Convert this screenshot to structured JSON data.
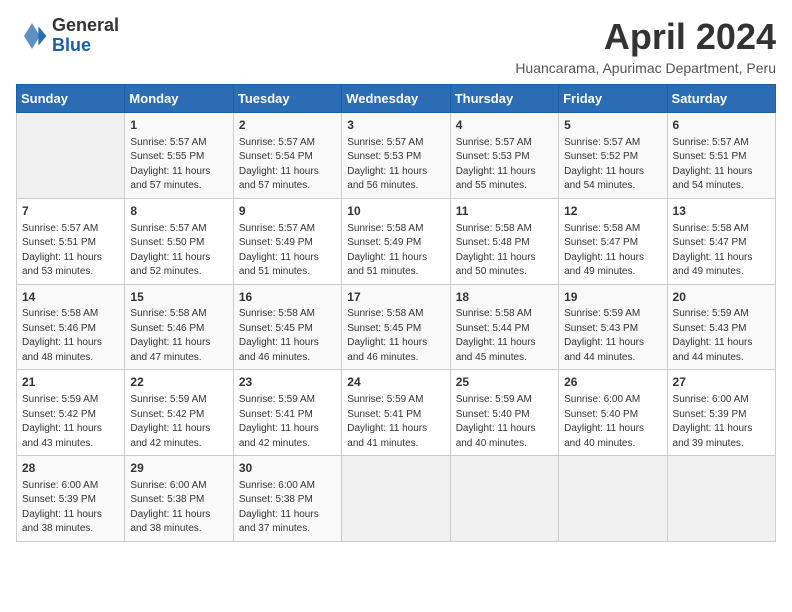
{
  "header": {
    "logo_general": "General",
    "logo_blue": "Blue",
    "month_title": "April 2024",
    "location": "Huancarama, Apurimac Department, Peru"
  },
  "days_of_week": [
    "Sunday",
    "Monday",
    "Tuesday",
    "Wednesday",
    "Thursday",
    "Friday",
    "Saturday"
  ],
  "weeks": [
    [
      {
        "day": "",
        "sunrise": "",
        "sunset": "",
        "daylight": ""
      },
      {
        "day": "1",
        "sunrise": "Sunrise: 5:57 AM",
        "sunset": "Sunset: 5:55 PM",
        "daylight": "Daylight: 11 hours and 57 minutes."
      },
      {
        "day": "2",
        "sunrise": "Sunrise: 5:57 AM",
        "sunset": "Sunset: 5:54 PM",
        "daylight": "Daylight: 11 hours and 57 minutes."
      },
      {
        "day": "3",
        "sunrise": "Sunrise: 5:57 AM",
        "sunset": "Sunset: 5:53 PM",
        "daylight": "Daylight: 11 hours and 56 minutes."
      },
      {
        "day": "4",
        "sunrise": "Sunrise: 5:57 AM",
        "sunset": "Sunset: 5:53 PM",
        "daylight": "Daylight: 11 hours and 55 minutes."
      },
      {
        "day": "5",
        "sunrise": "Sunrise: 5:57 AM",
        "sunset": "Sunset: 5:52 PM",
        "daylight": "Daylight: 11 hours and 54 minutes."
      },
      {
        "day": "6",
        "sunrise": "Sunrise: 5:57 AM",
        "sunset": "Sunset: 5:51 PM",
        "daylight": "Daylight: 11 hours and 54 minutes."
      }
    ],
    [
      {
        "day": "7",
        "sunrise": "Sunrise: 5:57 AM",
        "sunset": "Sunset: 5:51 PM",
        "daylight": "Daylight: 11 hours and 53 minutes."
      },
      {
        "day": "8",
        "sunrise": "Sunrise: 5:57 AM",
        "sunset": "Sunset: 5:50 PM",
        "daylight": "Daylight: 11 hours and 52 minutes."
      },
      {
        "day": "9",
        "sunrise": "Sunrise: 5:57 AM",
        "sunset": "Sunset: 5:49 PM",
        "daylight": "Daylight: 11 hours and 51 minutes."
      },
      {
        "day": "10",
        "sunrise": "Sunrise: 5:58 AM",
        "sunset": "Sunset: 5:49 PM",
        "daylight": "Daylight: 11 hours and 51 minutes."
      },
      {
        "day": "11",
        "sunrise": "Sunrise: 5:58 AM",
        "sunset": "Sunset: 5:48 PM",
        "daylight": "Daylight: 11 hours and 50 minutes."
      },
      {
        "day": "12",
        "sunrise": "Sunrise: 5:58 AM",
        "sunset": "Sunset: 5:47 PM",
        "daylight": "Daylight: 11 hours and 49 minutes."
      },
      {
        "day": "13",
        "sunrise": "Sunrise: 5:58 AM",
        "sunset": "Sunset: 5:47 PM",
        "daylight": "Daylight: 11 hours and 49 minutes."
      }
    ],
    [
      {
        "day": "14",
        "sunrise": "Sunrise: 5:58 AM",
        "sunset": "Sunset: 5:46 PM",
        "daylight": "Daylight: 11 hours and 48 minutes."
      },
      {
        "day": "15",
        "sunrise": "Sunrise: 5:58 AM",
        "sunset": "Sunset: 5:46 PM",
        "daylight": "Daylight: 11 hours and 47 minutes."
      },
      {
        "day": "16",
        "sunrise": "Sunrise: 5:58 AM",
        "sunset": "Sunset: 5:45 PM",
        "daylight": "Daylight: 11 hours and 46 minutes."
      },
      {
        "day": "17",
        "sunrise": "Sunrise: 5:58 AM",
        "sunset": "Sunset: 5:45 PM",
        "daylight": "Daylight: 11 hours and 46 minutes."
      },
      {
        "day": "18",
        "sunrise": "Sunrise: 5:58 AM",
        "sunset": "Sunset: 5:44 PM",
        "daylight": "Daylight: 11 hours and 45 minutes."
      },
      {
        "day": "19",
        "sunrise": "Sunrise: 5:59 AM",
        "sunset": "Sunset: 5:43 PM",
        "daylight": "Daylight: 11 hours and 44 minutes."
      },
      {
        "day": "20",
        "sunrise": "Sunrise: 5:59 AM",
        "sunset": "Sunset: 5:43 PM",
        "daylight": "Daylight: 11 hours and 44 minutes."
      }
    ],
    [
      {
        "day": "21",
        "sunrise": "Sunrise: 5:59 AM",
        "sunset": "Sunset: 5:42 PM",
        "daylight": "Daylight: 11 hours and 43 minutes."
      },
      {
        "day": "22",
        "sunrise": "Sunrise: 5:59 AM",
        "sunset": "Sunset: 5:42 PM",
        "daylight": "Daylight: 11 hours and 42 minutes."
      },
      {
        "day": "23",
        "sunrise": "Sunrise: 5:59 AM",
        "sunset": "Sunset: 5:41 PM",
        "daylight": "Daylight: 11 hours and 42 minutes."
      },
      {
        "day": "24",
        "sunrise": "Sunrise: 5:59 AM",
        "sunset": "Sunset: 5:41 PM",
        "daylight": "Daylight: 11 hours and 41 minutes."
      },
      {
        "day": "25",
        "sunrise": "Sunrise: 5:59 AM",
        "sunset": "Sunset: 5:40 PM",
        "daylight": "Daylight: 11 hours and 40 minutes."
      },
      {
        "day": "26",
        "sunrise": "Sunrise: 6:00 AM",
        "sunset": "Sunset: 5:40 PM",
        "daylight": "Daylight: 11 hours and 40 minutes."
      },
      {
        "day": "27",
        "sunrise": "Sunrise: 6:00 AM",
        "sunset": "Sunset: 5:39 PM",
        "daylight": "Daylight: 11 hours and 39 minutes."
      }
    ],
    [
      {
        "day": "28",
        "sunrise": "Sunrise: 6:00 AM",
        "sunset": "Sunset: 5:39 PM",
        "daylight": "Daylight: 11 hours and 38 minutes."
      },
      {
        "day": "29",
        "sunrise": "Sunrise: 6:00 AM",
        "sunset": "Sunset: 5:38 PM",
        "daylight": "Daylight: 11 hours and 38 minutes."
      },
      {
        "day": "30",
        "sunrise": "Sunrise: 6:00 AM",
        "sunset": "Sunset: 5:38 PM",
        "daylight": "Daylight: 11 hours and 37 minutes."
      },
      {
        "day": "",
        "sunrise": "",
        "sunset": "",
        "daylight": ""
      },
      {
        "day": "",
        "sunrise": "",
        "sunset": "",
        "daylight": ""
      },
      {
        "day": "",
        "sunrise": "",
        "sunset": "",
        "daylight": ""
      },
      {
        "day": "",
        "sunrise": "",
        "sunset": "",
        "daylight": ""
      }
    ]
  ]
}
